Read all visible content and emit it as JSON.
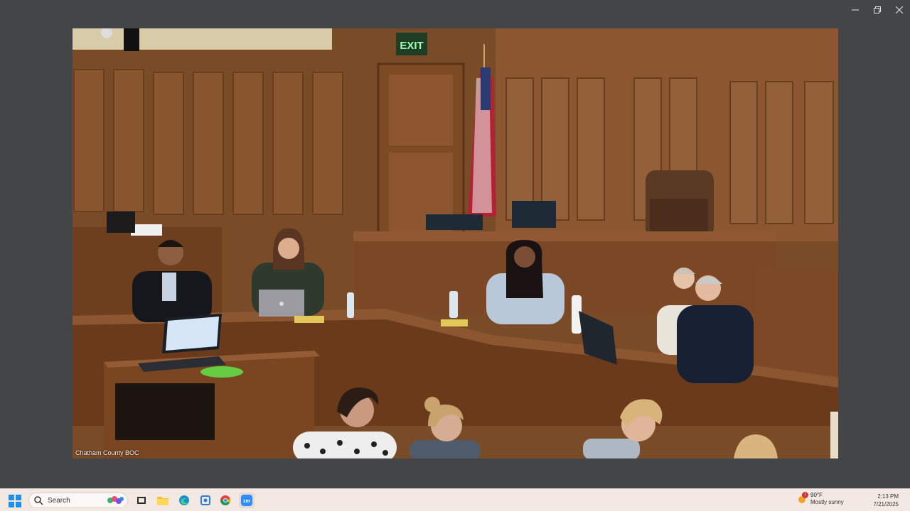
{
  "window": {
    "controls": {
      "minimize_icon": "minimize-icon",
      "maximize_icon": "restore-icon",
      "close_icon": "close-icon"
    }
  },
  "video": {
    "source_label": "Chatham County BOC",
    "scene": {
      "exit_sign": "EXIT"
    }
  },
  "taskbar": {
    "search_placeholder": "Search",
    "weather": {
      "temperature": "90°F",
      "condition": "Mostly sunny",
      "alert_badge": "!"
    },
    "clock": {
      "time": "2:13 PM",
      "date": "7/21/2025"
    },
    "apps": [
      "start-icon",
      "search-icon",
      "task-view-icon",
      "file-explorer-icon",
      "edge-icon",
      "snipping-tool-icon",
      "chrome-icon",
      "zoom-icon"
    ],
    "colors": {
      "background": "#f3e8e2",
      "zoom": "#2d8cff",
      "edge": "#1a8fd0",
      "folder": "#f5c024"
    }
  }
}
